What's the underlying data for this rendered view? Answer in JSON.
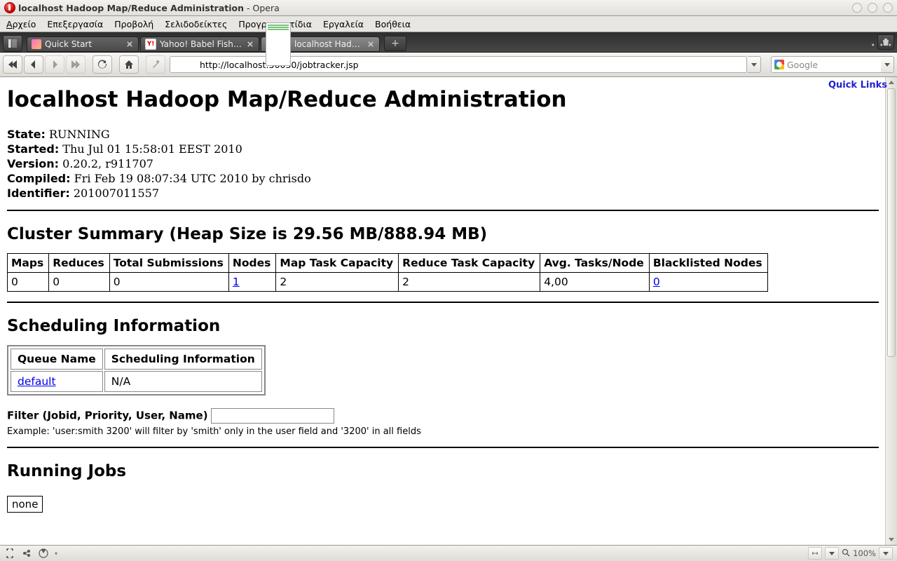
{
  "window": {
    "title_page": "localhost Hadoop Map/Reduce Administration",
    "title_app": " - Opera"
  },
  "menus": {
    "file": "Αρχείο",
    "edit": "Επεξεργασία",
    "view": "Προβολή",
    "bookmarks": "Σελιδοδείκτες",
    "widgets": "Προγραμματίδια",
    "tools": "Εργαλεία",
    "help": "Βοήθεια"
  },
  "tabs": {
    "t1": "Quick Start",
    "t2": "Yahoo! Babel Fish - T...",
    "t3": "localhost Hadoop Ma..."
  },
  "nav": {
    "url": "http://localhost:50030/jobtracker.jsp",
    "search_placeholder": "Google"
  },
  "page": {
    "quick_links": "Quick Links",
    "h1": "localhost Hadoop Map/Reduce Administration",
    "state_label": "State:",
    "state_value": " RUNNING",
    "started_label": "Started:",
    "started_value": " Thu Jul 01 15:58:01 EEST 2010",
    "version_label": "Version:",
    "version_value": " 0.20.2, r911707",
    "compiled_label": "Compiled:",
    "compiled_value": " Fri Feb 19 08:07:34 UTC 2010 by chrisdo",
    "identifier_label": "Identifier:",
    "identifier_value": " 201007011557",
    "cluster_heading": "Cluster Summary (Heap Size is 29.56 MB/888.94 MB)",
    "cluster_headers": {
      "maps": "Maps",
      "reduces": "Reduces",
      "total_sub": "Total Submissions",
      "nodes": "Nodes",
      "map_cap": "Map Task Capacity",
      "reduce_cap": "Reduce Task Capacity",
      "avg": "Avg. Tasks/Node",
      "blacklisted": "Blacklisted Nodes"
    },
    "cluster_row": {
      "maps": "0",
      "reduces": "0",
      "total_sub": "0",
      "nodes": "1",
      "map_cap": "2",
      "reduce_cap": "2",
      "avg": "4,00",
      "blacklisted": "0"
    },
    "sched_heading": "Scheduling Information",
    "sched_headers": {
      "queue": "Queue Name",
      "info": "Scheduling Information"
    },
    "sched_row": {
      "queue": "default",
      "info": "N/A"
    },
    "filter_label": "Filter (Jobid, Priority, User, Name)",
    "filter_example": "Example: 'user:smith 3200' will filter by 'smith' only in the user field and '3200' in all fields",
    "running_heading": "Running Jobs",
    "none": "none"
  },
  "status": {
    "zoom": "100%"
  }
}
